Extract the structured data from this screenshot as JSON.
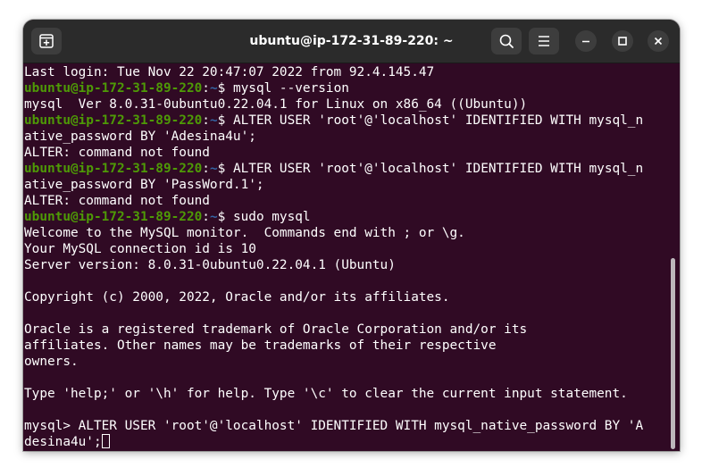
{
  "window": {
    "title": "ubuntu@ip-172-31-89-220: ~"
  },
  "icons": {
    "new_tab": "new-tab-icon",
    "search": "search-icon",
    "menu": "hamburger-menu-icon",
    "minimize": "minimize-icon",
    "maximize": "maximize-icon",
    "close": "close-icon"
  },
  "colors": {
    "terminal_bg": "#300a24",
    "titlebar_bg": "#2b2b2b",
    "prompt_user": "#4e9a06",
    "prompt_path": "#3465a4",
    "text": "#ffffff"
  },
  "prompt": {
    "user_host": "ubuntu@ip-172-31-89-220",
    "sep": ":",
    "path": "~",
    "symbol": "$ "
  },
  "terminal": {
    "lines": [
      {
        "type": "text",
        "text": "Last login: Tue Nov 22 20:47:07 2022 from 92.4.145.47"
      },
      {
        "type": "prompt",
        "text": "mysql --version"
      },
      {
        "type": "text",
        "text": "mysql  Ver 8.0.31-0ubuntu0.22.04.1 for Linux on x86_64 ((Ubuntu))"
      },
      {
        "type": "prompt",
        "text": "ALTER USER 'root'@'localhost' IDENTIFIED WITH mysql_n"
      },
      {
        "type": "text",
        "text": "ative_password BY 'Adesina4u';"
      },
      {
        "type": "text",
        "text": "ALTER: command not found"
      },
      {
        "type": "prompt",
        "text": "ALTER USER 'root'@'localhost' IDENTIFIED WITH mysql_n"
      },
      {
        "type": "text",
        "text": "ative_password BY 'PassWord.1';"
      },
      {
        "type": "text",
        "text": "ALTER: command not found"
      },
      {
        "type": "prompt",
        "text": "sudo mysql"
      },
      {
        "type": "text",
        "text": "Welcome to the MySQL monitor.  Commands end with ; or \\g."
      },
      {
        "type": "text",
        "text": "Your MySQL connection id is 10"
      },
      {
        "type": "text",
        "text": "Server version: 8.0.31-0ubuntu0.22.04.1 (Ubuntu)"
      },
      {
        "type": "text",
        "text": ""
      },
      {
        "type": "text",
        "text": "Copyright (c) 2000, 2022, Oracle and/or its affiliates."
      },
      {
        "type": "text",
        "text": ""
      },
      {
        "type": "text",
        "text": "Oracle is a registered trademark of Oracle Corporation and/or its"
      },
      {
        "type": "text",
        "text": "affiliates. Other names may be trademarks of their respective"
      },
      {
        "type": "text",
        "text": "owners."
      },
      {
        "type": "text",
        "text": ""
      },
      {
        "type": "text",
        "text": "Type 'help;' or '\\h' for help. Type '\\c' to clear the current input statement."
      },
      {
        "type": "text",
        "text": ""
      },
      {
        "type": "text",
        "text": "mysql> ALTER USER 'root'@'localhost' IDENTIFIED WITH mysql_native_password BY 'A"
      },
      {
        "type": "cursor",
        "text": "desina4u';"
      }
    ]
  }
}
